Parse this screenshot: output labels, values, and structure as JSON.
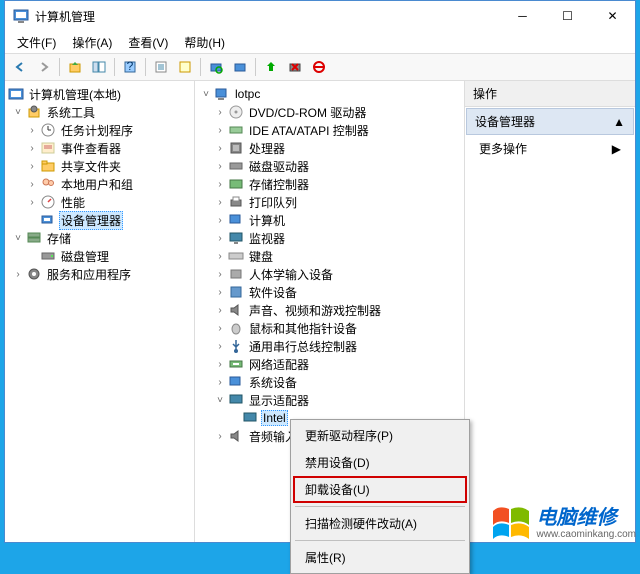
{
  "window": {
    "title": "计算机管理",
    "min": "─",
    "max": "☐",
    "close": "✕"
  },
  "menu": {
    "file": "文件(F)",
    "action": "操作(A)",
    "view": "查看(V)",
    "help": "帮助(H)"
  },
  "left_tree": {
    "root": "计算机管理(本地)",
    "sys_tools": "系统工具",
    "task_sched": "任务计划程序",
    "event_viewer": "事件查看器",
    "shared": "共享文件夹",
    "local_users": "本地用户和组",
    "perf": "性能",
    "dev_mgr": "设备管理器",
    "storage": "存储",
    "disk_mgmt": "磁盘管理",
    "svc_apps": "服务和应用程序"
  },
  "mid_tree": {
    "root": "lotpc",
    "dvd": "DVD/CD-ROM 驱动器",
    "ide": "IDE ATA/ATAPI 控制器",
    "cpu": "处理器",
    "disk": "磁盘驱动器",
    "storage_ctrl": "存储控制器",
    "print": "打印队列",
    "computer": "计算机",
    "monitor": "监视器",
    "keyboard": "键盘",
    "hid": "人体学输入设备",
    "sw_dev": "软件设备",
    "audio_game": "声音、视频和游戏控制器",
    "mouse": "鼠标和其他指针设备",
    "usb": "通用串行总线控制器",
    "net": "网络适配器",
    "sys_dev": "系统设备",
    "display": "显示适配器",
    "intel": "Intel",
    "audio_in": "音频输入"
  },
  "context_menu": {
    "update": "更新驱动程序(P)",
    "disable": "禁用设备(D)",
    "uninstall": "卸载设备(U)",
    "scan": "扫描检测硬件改动(A)",
    "props": "属性(R)"
  },
  "right_pane": {
    "header": "操作",
    "section": "设备管理器",
    "more": "更多操作"
  },
  "watermark": {
    "cn": "电脑维修",
    "en": "www.caominkang.com"
  }
}
